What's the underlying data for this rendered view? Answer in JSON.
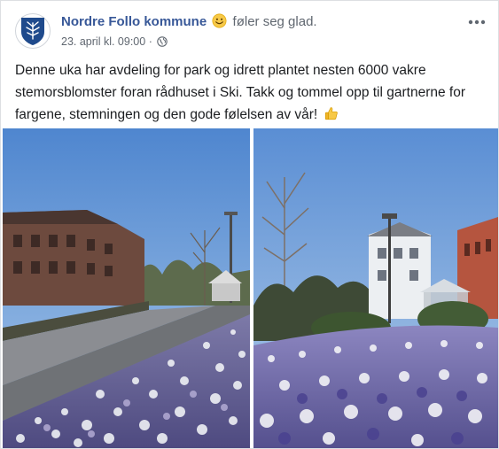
{
  "post": {
    "author": "Nordre Follo kommune",
    "feeling": "føler seg glad.",
    "date": "23. april kl. 09:00",
    "separator": "·",
    "audience_icon": "globe-icon",
    "more_icon": "more-dots-icon",
    "emoji_icon": "smiley-emoji-icon",
    "body": "Denne uka har avdeling for park og idrett plantet nesten 6000 vakre stemorsblomster foran rådhuset i Ski. Takk og tommel opp til gartnerne for fargene, stemningen og den gode følelsen av vår!",
    "body_emoji": "thumbs-up-emoji-icon"
  },
  "colors": {
    "author": "#385898",
    "meta": "#606770",
    "text": "#1c1e21",
    "logo": "#1f4a8c",
    "sky": "#5d8fd0",
    "pansy_purple": "#6a5fa8",
    "pansy_white": "#f2f2f5"
  }
}
